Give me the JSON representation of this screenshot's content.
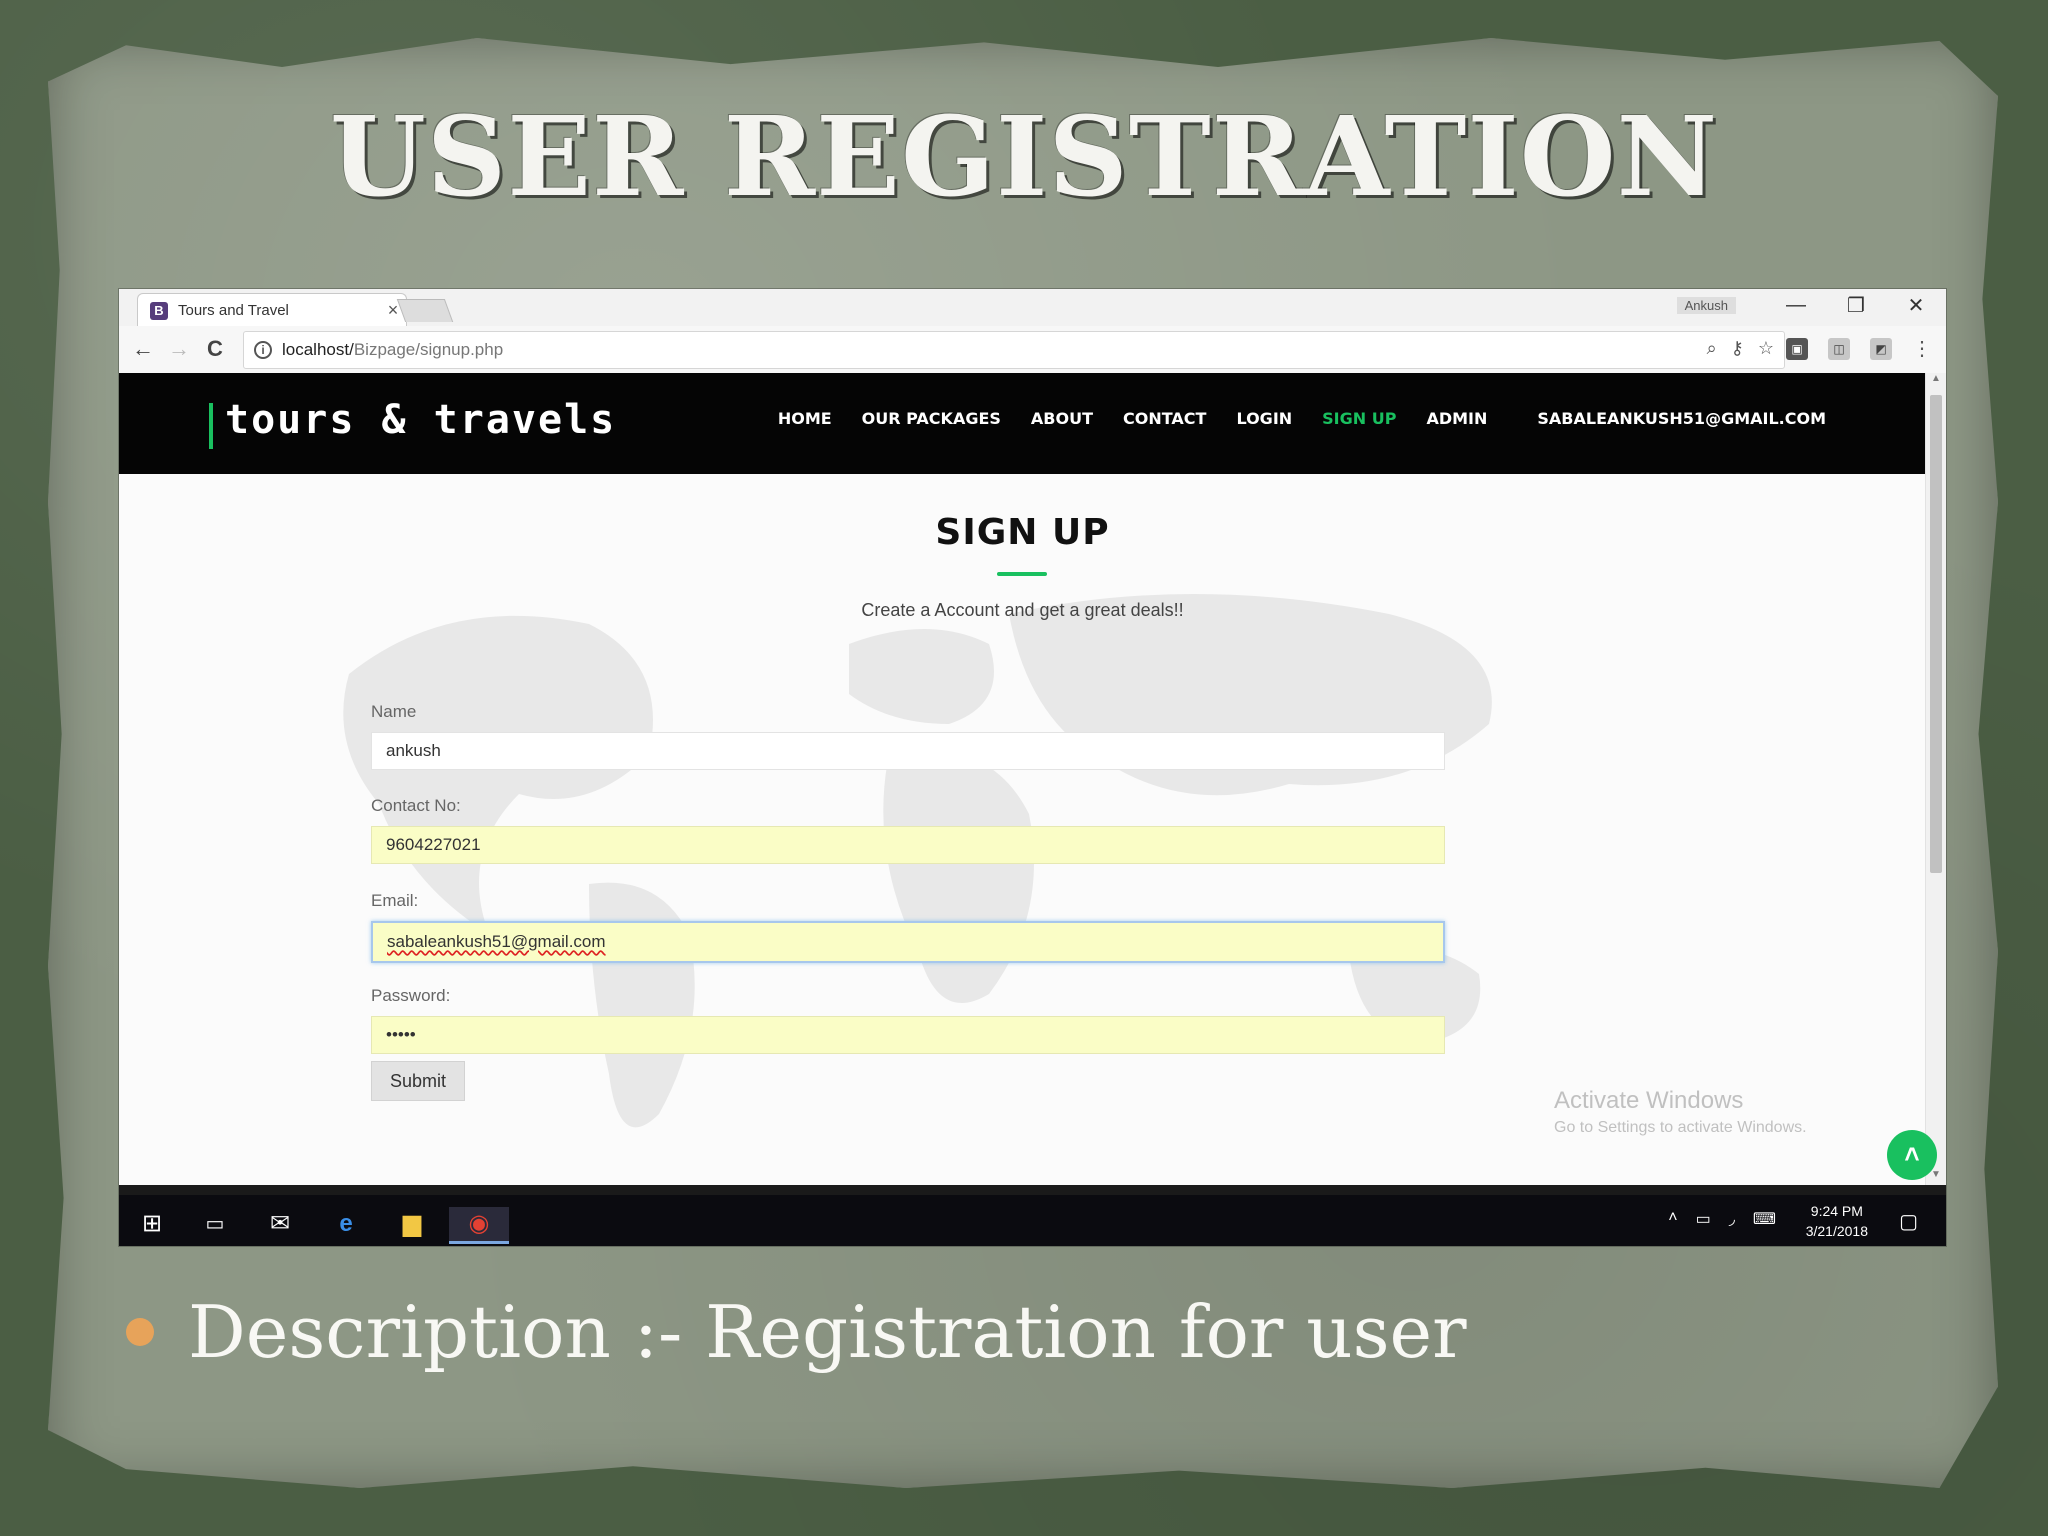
{
  "slide": {
    "title": "USER REGISTRATION",
    "bullet": "Description :- Registration for user"
  },
  "browser": {
    "tab_title": "Tours and Travel",
    "tab_favicon": "B",
    "tab_close": "×",
    "window_user": "Ankush",
    "window_buttons": [
      "—",
      "❐",
      "✕"
    ],
    "url_host": "localhost/",
    "url_path": "Bizpage/signup.php",
    "back": "←",
    "forward": "→",
    "reload": "C",
    "omni_icons": [
      "zoom-icon",
      "key-icon",
      "star-icon"
    ]
  },
  "site": {
    "brand": "tours & travels",
    "menu": [
      "HOME",
      "OUR PACKAGES",
      "ABOUT",
      "CONTACT",
      "LOGIN",
      "SIGN UP",
      "ADMIN",
      "SABALEANKUSH51@GMAIL.COM"
    ],
    "active_menu": "SIGN UP",
    "accent": "#19c05f"
  },
  "form": {
    "heading": "SIGN UP",
    "subtitle": "Create a Account and get a great deals!!",
    "name_label": "Name",
    "name_value": "ankush",
    "contact_label": "Contact No:",
    "contact_value": "9604227021",
    "email_label": "Email:",
    "email_value": "sabaleankush51@gmail.com",
    "password_label": "Password:",
    "password_value": "•••••",
    "submit_label": "Submit"
  },
  "watermark": {
    "line1": "Activate Windows",
    "line2": "Go to Settings to activate Windows."
  },
  "taskbar": {
    "time": "9:24 PM",
    "date": "3/21/2018"
  }
}
